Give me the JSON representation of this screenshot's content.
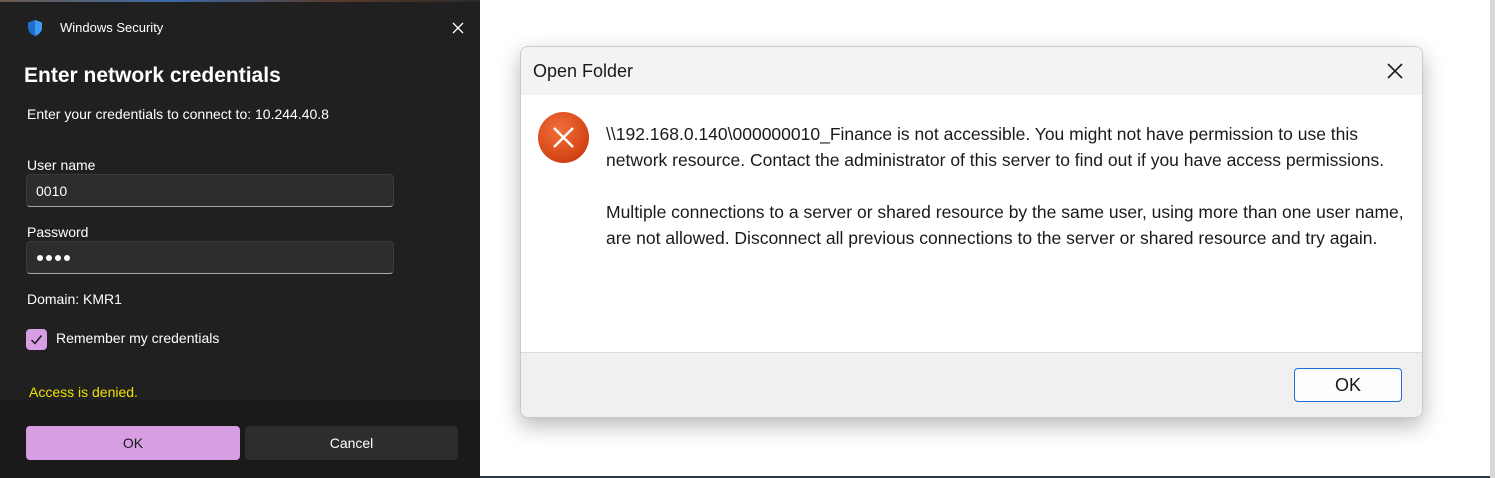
{
  "security_dialog": {
    "app_title": "Windows Security",
    "heading": "Enter network credentials",
    "prompt": "Enter your credentials to connect to: 10.244.40.8",
    "username_label": "User name",
    "username_value": "0010",
    "password_label": "Password",
    "password_masked_length": 4,
    "domain": "Domain: KMR1",
    "remember_label": "Remember my credentials",
    "remember_checked": true,
    "error": "Access is denied.",
    "ok_label": "OK",
    "cancel_label": "Cancel",
    "icons": {
      "app": "shield-icon",
      "close": "close-icon",
      "check": "checkmark-icon"
    },
    "colors": {
      "background": "#202020",
      "accent": "#d79ee3",
      "error": "#f0e000"
    }
  },
  "open_folder_dialog": {
    "title": "Open Folder",
    "message_1": "\\\\192.168.0.140\\000000010_Finance is not accessible. You might not have permission to use this network resource. Contact the administrator of this server to find out if you have access permissions.",
    "message_2": "Multiple connections to a server or shared resource by the same user, using more than one user name, are not allowed. Disconnect all previous connections to the server or shared resource and try again.",
    "ok_label": "OK",
    "icons": {
      "status": "error-icon",
      "close": "close-icon"
    },
    "colors": {
      "error_icon": "#d9491a",
      "button_border": "#1a6fd6"
    }
  }
}
